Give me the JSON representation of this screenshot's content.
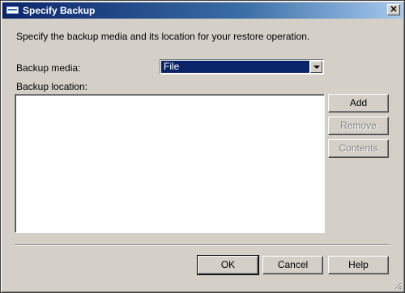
{
  "window": {
    "title": "Specify Backup",
    "close_label": "✕"
  },
  "dialog": {
    "instruction": "Specify the backup media and its location for your restore operation.",
    "backup_media_label": "Backup media:",
    "backup_media_value": "File",
    "backup_location_label": "Backup location:",
    "location_items": []
  },
  "side_buttons": {
    "add": "Add",
    "remove": "Remove",
    "contents": "Contents"
  },
  "footer_buttons": {
    "ok": "OK",
    "cancel": "Cancel",
    "help": "Help"
  },
  "colors": {
    "title_start": "#0a246a",
    "title_end": "#a6caf0",
    "face": "#d4d0c8",
    "selection": "#0a246a"
  }
}
